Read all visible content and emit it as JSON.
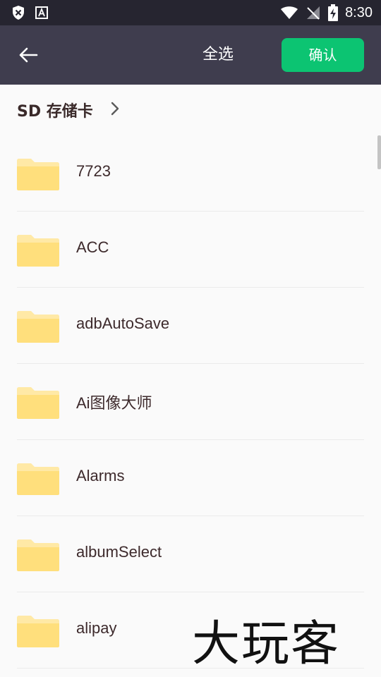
{
  "status_bar": {
    "time": "8:30",
    "left_icons": [
      "shield-x-icon",
      "font-a-icon"
    ],
    "right_icons": [
      "wifi-icon",
      "no-signal-icon",
      "battery-charging-icon"
    ]
  },
  "toolbar": {
    "select_all_label": "全选",
    "confirm_label": "确认",
    "back_icon": "back-arrow-icon",
    "confirm_color": "#0cc472",
    "bar_color": "#3f3d4e"
  },
  "breadcrumb": {
    "label": "SD 存储卡",
    "icon": "chevron-right-icon"
  },
  "folders": [
    {
      "name": "7723"
    },
    {
      "name": "ACC"
    },
    {
      "name": "adbAutoSave"
    },
    {
      "name": "Ai图像大师"
    },
    {
      "name": "Alarms"
    },
    {
      "name": "albumSelect"
    },
    {
      "name": "alipay"
    }
  ],
  "watermark": {
    "text": "大玩客"
  }
}
